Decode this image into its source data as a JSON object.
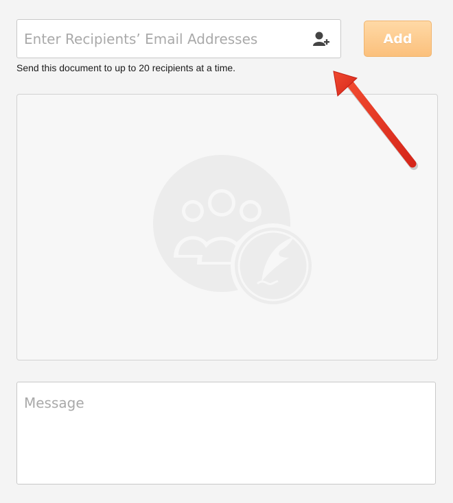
{
  "recipients": {
    "placeholder": "Enter Recipients’ Email Addresses",
    "value": "",
    "add_contact_icon": "add-contact-icon",
    "helper": "Send this document to up to 20 recipients at a time."
  },
  "add_button": {
    "label": "Add"
  },
  "panel": {
    "illustration_icons": [
      "group-icon",
      "quill-icon"
    ]
  },
  "message": {
    "placeholder": "Message",
    "value": ""
  },
  "colors": {
    "accent_button": "#fbc07c",
    "arrow": "#e8321f",
    "background": "#f4f4f4"
  }
}
